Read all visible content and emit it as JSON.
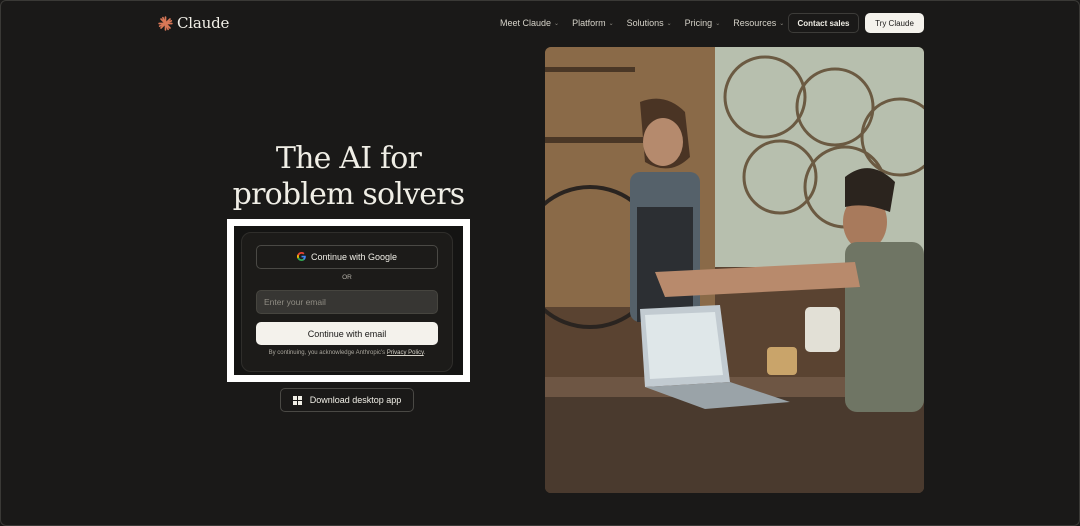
{
  "header": {
    "brand": "Claude",
    "nav": [
      {
        "label": "Meet Claude"
      },
      {
        "label": "Platform"
      },
      {
        "label": "Solutions"
      },
      {
        "label": "Pricing"
      },
      {
        "label": "Resources"
      }
    ],
    "contact_sales": "Contact sales",
    "try_claude": "Try Claude"
  },
  "hero": {
    "headline_line1": "The AI for",
    "headline_line2": "problem solvers"
  },
  "auth": {
    "google_button": "Continue with Google",
    "or_label": "OR",
    "email_placeholder": "Enter your email",
    "email_value": "",
    "email_button": "Continue with email",
    "disclaimer_prefix": "By continuing, you acknowledge Anthropic's",
    "privacy_link": "Privacy Policy",
    "disclaimer_suffix": "."
  },
  "download": {
    "label": "Download desktop app"
  },
  "colors": {
    "background": "#1a1918",
    "accent": "#d97757",
    "text": "#f0eee6",
    "button_light": "#f4f2ec"
  },
  "icons": {
    "logo": "claude-starburst-icon",
    "google": "google-icon",
    "windows": "windows-icon",
    "chevron": "chevron-down-icon"
  }
}
